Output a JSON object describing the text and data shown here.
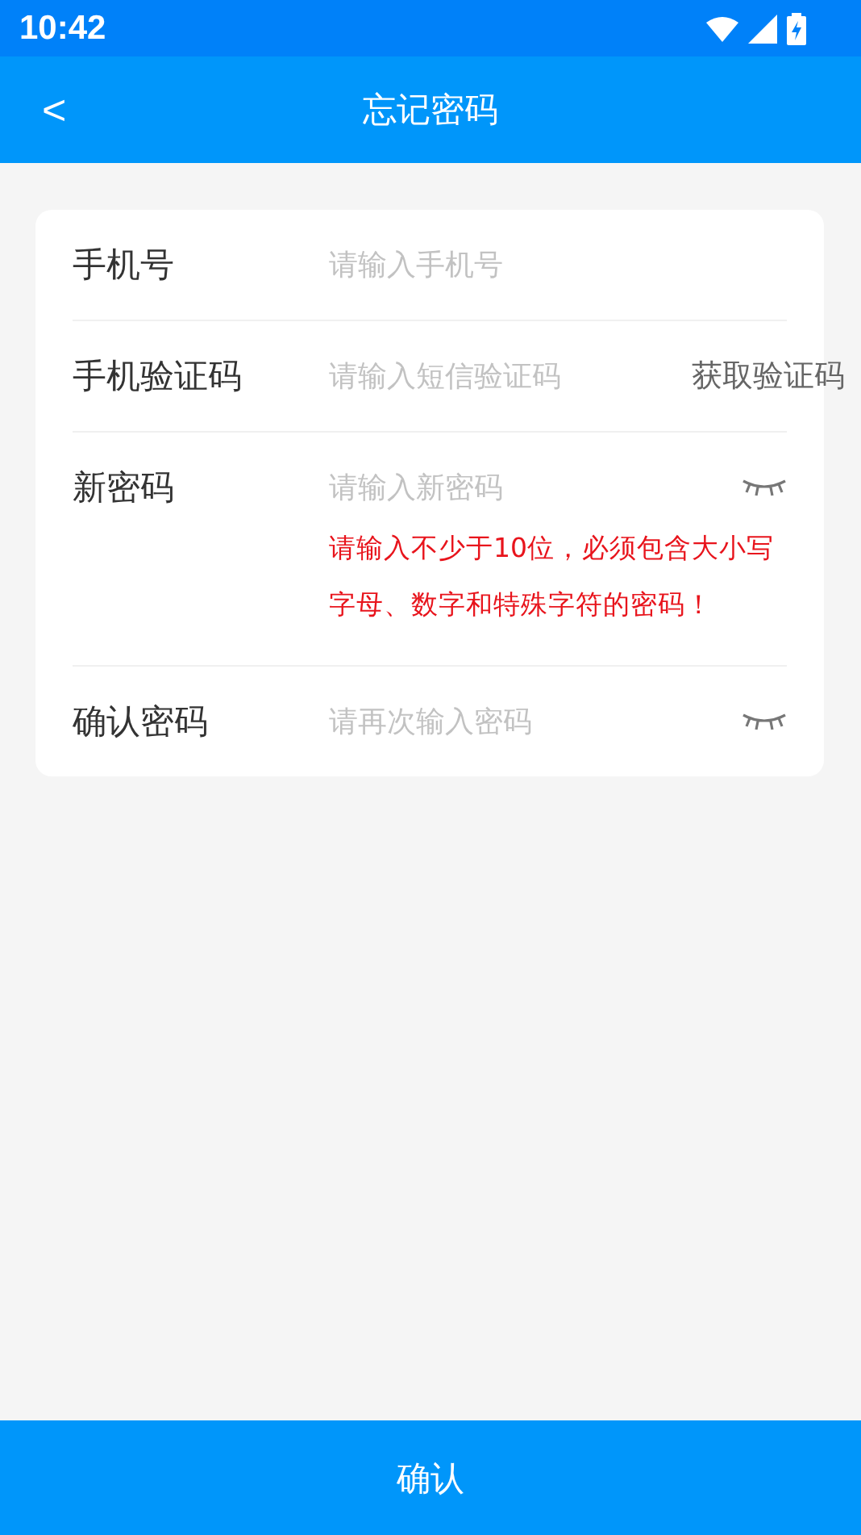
{
  "status_bar": {
    "time": "10:42"
  },
  "header": {
    "back": "<",
    "title": "忘记密码"
  },
  "form": [
    {
      "kind": "text",
      "label": "手机号",
      "placeholder": "请输入手机号"
    },
    {
      "kind": "code",
      "label": "手机验证码",
      "placeholder": "请输入短信验证码",
      "action": "获取验证码"
    },
    {
      "kind": "password",
      "label": "新密码",
      "placeholder": "请输入新密码",
      "hint": "请输入不少于10位，必须包含大小写字母、数字和特殊字符的密码！"
    },
    {
      "kind": "password",
      "label": "确认密码",
      "placeholder": "请再次输入密码"
    }
  ],
  "submit": "确认"
}
